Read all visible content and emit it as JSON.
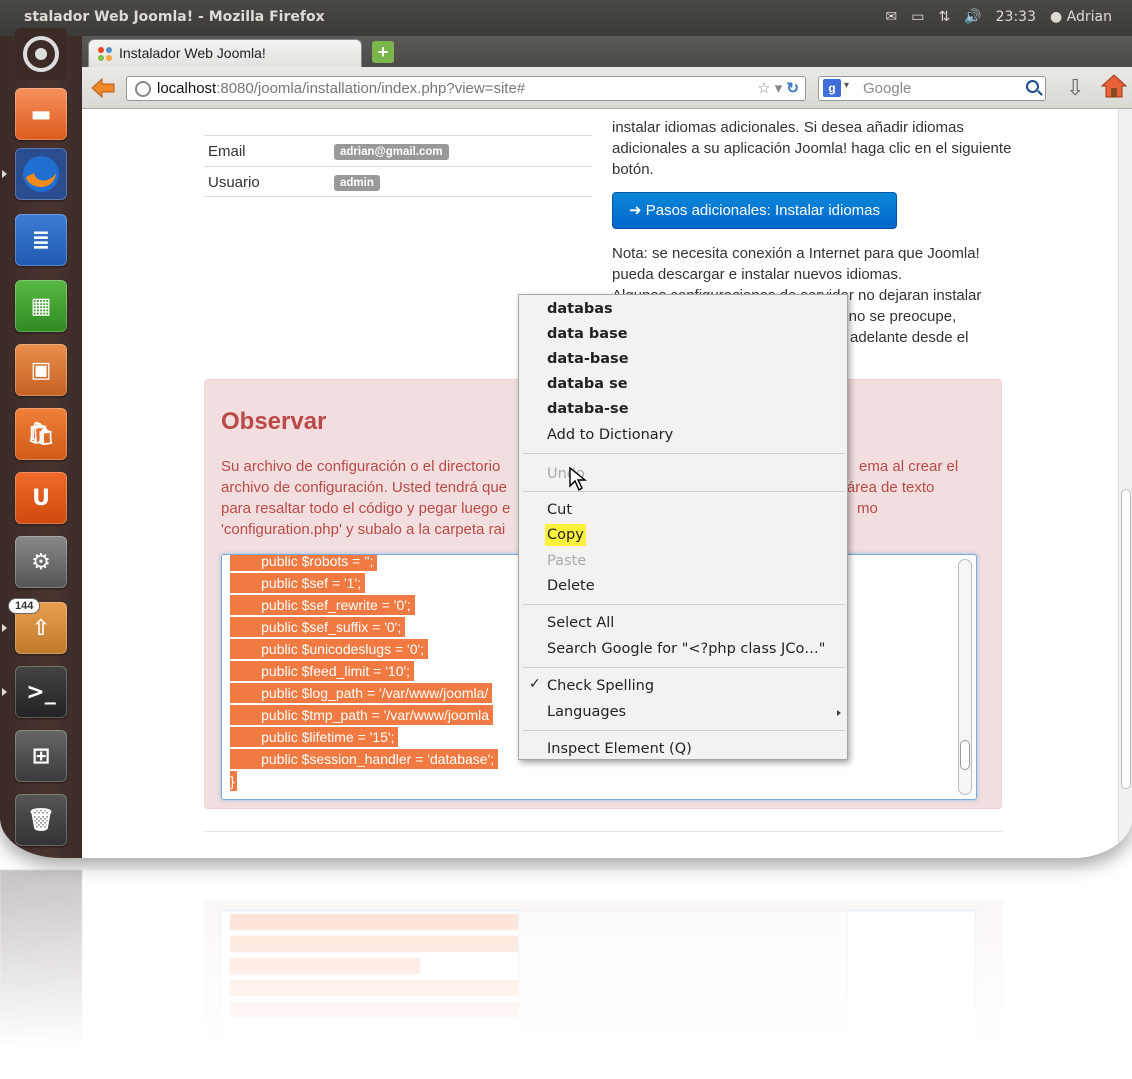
{
  "window": {
    "title": "stalador Web Joomla! - Mozilla Firefox",
    "clock": "23:33",
    "user": "Adrian"
  },
  "launcher": {
    "badge": "144"
  },
  "browser": {
    "tab_title": "Instalador Web Joomla!",
    "url_host": "localhost",
    "url_rest": ":8080/joomla/installation/index.php?view=site#",
    "search_placeholder": "Google"
  },
  "page": {
    "info_rows": [
      {
        "label": "Email",
        "value": "adrian@gmail.com"
      },
      {
        "label": "Usuario",
        "value": "admin"
      }
    ],
    "right_text_1": "instalar idiomas adicionales. Si desea añadir idiomas adicionales a su aplicación Joomla! haga clic en el siguiente botón.",
    "lang_button": "➜ Pasos adicionales: Instalar idiomas",
    "right_text_2": "Nota: se necesita conexión a Internet para que Joomla! pueda descargar e instalar nuevos idiomas.",
    "right_text_3": "Algunas configuraciones de servidor no dejaran instalar",
    "right_text_4": "o, no se preocupe,",
    "right_text_5": "adelante desde el",
    "alert_title": "Observar",
    "alert_line_1_a": "Su archivo de configuración o el directorio",
    "alert_line_1_b": "ema al crear el",
    "alert_line_2_a": "archivo de configuración. Usted tendrá que",
    "alert_line_2_b": "el área de texto",
    "alert_line_3_a": "para resaltar todo el código y pegar luego e",
    "alert_line_3_b": "mo",
    "alert_line_4_a": "'configuration.php' y subalo a la carpeta rai",
    "code_lines": [
      "        public $robots = '';",
      "        public $sef = '1';",
      "        public $sef_rewrite = '0';",
      "        public $sef_suffix = '0';",
      "        public $unicodeslugs = '0';",
      "        public $feed_limit = '10';",
      "        public $log_path = '/var/www/joomla/",
      "        public $tmp_path = '/var/www/joomla",
      "        public $lifetime = '15';",
      "        public $session_handler = 'database';",
      "}"
    ]
  },
  "context_menu": {
    "suggestions": [
      "databas",
      "data base",
      "data-base",
      "databa se",
      "databa-se"
    ],
    "add_to_dictionary": "Add to Dictionary",
    "undo": "Undo",
    "cut": "Cut",
    "copy": "Copy",
    "paste": "Paste",
    "delete": "Delete",
    "select_all": "Select All",
    "search_google": "Search Google for \"<?php class JCo…\"",
    "check_spelling": "Check Spelling",
    "languages": "Languages",
    "inspect": "Inspect Element (Q)"
  }
}
